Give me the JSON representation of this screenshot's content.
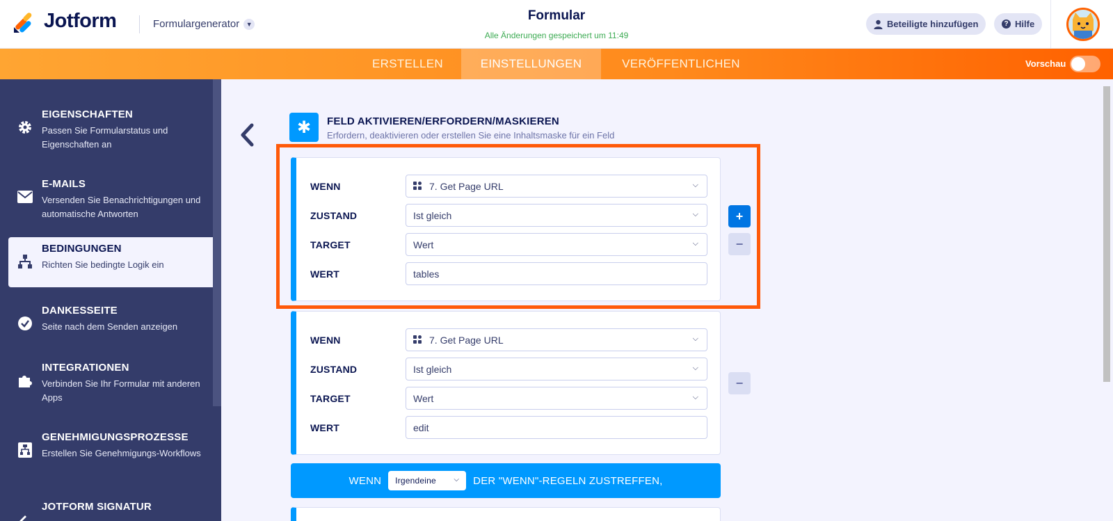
{
  "header": {
    "brand": "Jotform",
    "builder_label": "Formulargenerator",
    "form_title": "Formular",
    "saved_status": "Alle Änderungen gespeichert um 11:49",
    "collaborators_label": "Beteiligte hinzufügen",
    "help_label": "Hilfe"
  },
  "nav": {
    "tabs": [
      "ERSTELLEN",
      "EINSTELLUNGEN",
      "VERÖFFENTLICHEN"
    ],
    "active_tab": "EINSTELLUNGEN",
    "preview_label": "Vorschau",
    "preview_on": false
  },
  "sidebar": {
    "items": [
      {
        "title": "EIGENSCHAFTEN",
        "desc": "Passen Sie Formularstatus und Eigenschaften an",
        "icon": "gear-icon"
      },
      {
        "title": "E-MAILS",
        "desc": "Versenden Sie Benachrichtigungen und automatische Antworten",
        "icon": "envelope-icon"
      },
      {
        "title": "BEDINGUNGEN",
        "desc": "Richten Sie bedingte Logik ein",
        "icon": "sitemap-icon"
      },
      {
        "title": "DANKESSEITE",
        "desc": "Seite nach dem Senden anzeigen",
        "icon": "check-circle-icon"
      },
      {
        "title": "INTEGRATIONEN",
        "desc": "Verbinden Sie Ihr Formular mit anderen Apps",
        "icon": "puzzle-icon"
      },
      {
        "title": "GENEHMIGUNGSPROZESSE",
        "desc": "Erstellen Sie Genehmigungs-Workflows",
        "icon": "workflow-icon"
      },
      {
        "title": "JOTFORM SIGNATUR",
        "desc": "",
        "icon": "signature-icon"
      }
    ],
    "active": "BEDINGUNGEN"
  },
  "section": {
    "title": "FELD AKTIVIEREN/ERFORDERN/MASKIEREN",
    "subtitle": "Erfordern, deaktivieren oder erstellen Sie eine Inhaltsmaske für ein Feld",
    "icon": "asterisk-icon"
  },
  "labels": {
    "if": "WENN",
    "state": "ZUSTAND",
    "target": "TARGET",
    "value": "WERT"
  },
  "conditions": [
    {
      "field": "7. Get Page URL",
      "state": "Ist gleich",
      "target": "Wert",
      "value": "tables"
    },
    {
      "field": "7. Get Page URL",
      "state": "Ist gleich",
      "target": "Wert",
      "value": "edit"
    }
  ],
  "rule_bar": {
    "prefix": "WENN",
    "selected": "Irgendeine",
    "suffix": "DER \"WENN\"-REGELN ZUSTREFFEN,"
  },
  "colors": {
    "accent": "#0099ff",
    "brand_orange": "#ff6100",
    "highlight": "#ff5a0a",
    "sidebar": "#343c6a"
  }
}
